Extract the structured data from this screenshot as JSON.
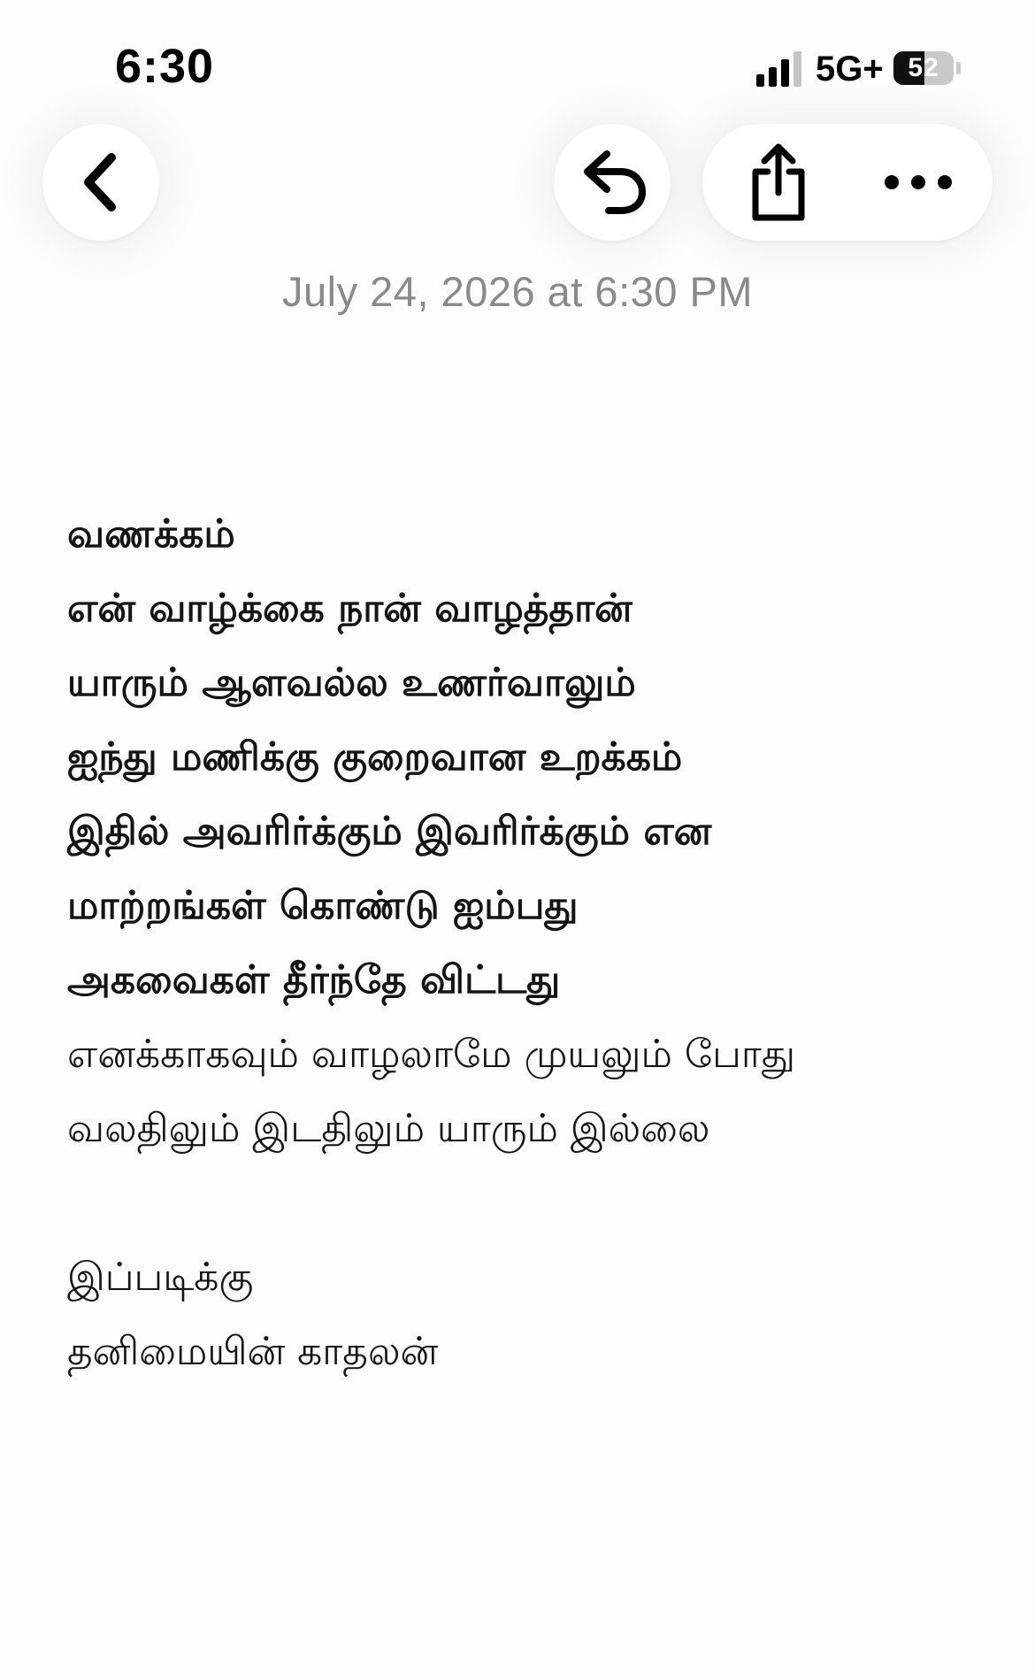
{
  "status_bar": {
    "time": "6:30",
    "network": "5G+",
    "battery_level": "52",
    "battery_fraction": 0.52,
    "signal_icon": "signal-bars-icon"
  },
  "toolbar": {
    "back_icon": "chevron-left-icon",
    "reply_icon": "undo-arrow-icon",
    "share_icon": "share-icon",
    "more_icon": "ellipsis-icon"
  },
  "note": {
    "date": "July 24, 2026 at 6:30 PM",
    "bold_lines": [
      "வணக்கம்",
      "என் வாழ்க்கை நான் வாழத்தான்",
      "யாரும் ஆளவல்ல உணர்வாலும்",
      "ஐந்து மணிக்கு குறைவான உறக்கம்",
      "இதில் அவரிர்க்கும்  இவரிர்க்கும் என",
      "மாற்றங்கள்  கொண்டு ஐம்பது",
      "அகவைகள்  தீர்ந்தே விட்டது"
    ],
    "regular_lines": [
      "எனக்காகவும் வாழலாமே முயலும் போது",
      "வலதிலும் இடதிலும் யாரும் இல்லை"
    ],
    "closing_lines": [
      "இப்படிக்கு",
      "தனிமையின் காதலன்"
    ]
  }
}
